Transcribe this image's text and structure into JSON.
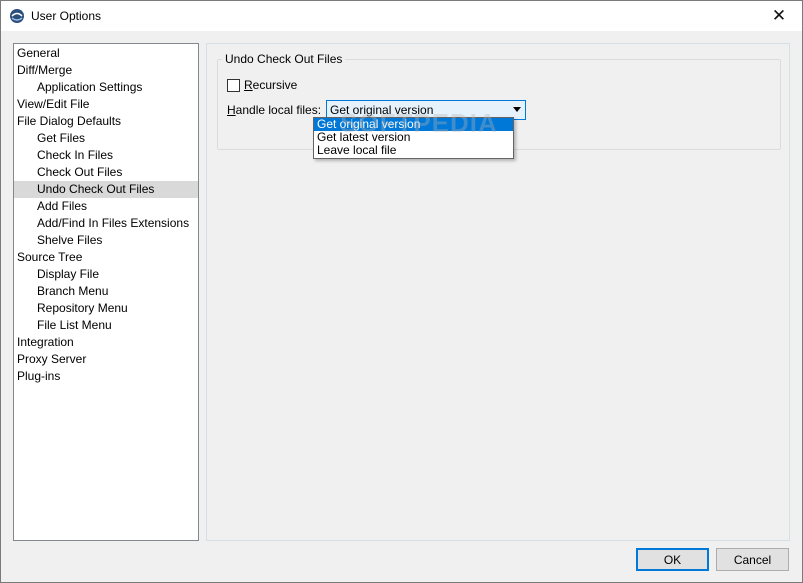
{
  "window": {
    "title": "User Options",
    "close_glyph": "✕"
  },
  "tree": {
    "items": [
      {
        "label": "General",
        "level": 0
      },
      {
        "label": "Diff/Merge",
        "level": 0
      },
      {
        "label": "Application Settings",
        "level": 1
      },
      {
        "label": "View/Edit File",
        "level": 0
      },
      {
        "label": "File Dialog Defaults",
        "level": 0
      },
      {
        "label": "Get Files",
        "level": 1
      },
      {
        "label": "Check In Files",
        "level": 1
      },
      {
        "label": "Check Out Files",
        "level": 1
      },
      {
        "label": "Undo Check Out Files",
        "level": 1,
        "selected": true
      },
      {
        "label": "Add Files",
        "level": 1
      },
      {
        "label": "Add/Find In Files Extensions",
        "level": 1
      },
      {
        "label": "Shelve Files",
        "level": 1
      },
      {
        "label": "Source Tree",
        "level": 0
      },
      {
        "label": "Display File",
        "level": 1
      },
      {
        "label": "Branch Menu",
        "level": 1
      },
      {
        "label": "Repository Menu",
        "level": 1
      },
      {
        "label": "File List Menu",
        "level": 1
      },
      {
        "label": "Integration",
        "level": 0
      },
      {
        "label": "Proxy Server",
        "level": 0
      },
      {
        "label": "Plug-ins",
        "level": 0
      }
    ]
  },
  "panel": {
    "group_title": "Undo Check Out Files",
    "recursive": {
      "label_accel": "R",
      "label_rest": "ecursive",
      "checked": false
    },
    "handle": {
      "label_accel": "H",
      "label_rest": "andle local files:",
      "selected": "Get original version",
      "options": [
        "Get original version",
        "Get latest version",
        "Leave local file"
      ]
    }
  },
  "watermark": "SOFTPEDIA",
  "buttons": {
    "ok": "OK",
    "cancel": "Cancel"
  },
  "colors": {
    "accent": "#0078d7",
    "tree_selected": "#d9d9d9"
  },
  "icons": {
    "app": "app-logo-icon",
    "close": "close-icon",
    "dropdown": "chevron-down-icon"
  }
}
